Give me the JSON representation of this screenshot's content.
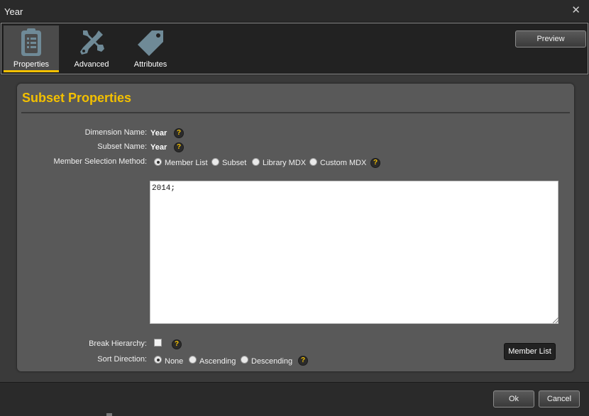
{
  "window": {
    "title": "Year",
    "close_glyph": "✕"
  },
  "toolbar": {
    "tabs": [
      {
        "label": "Properties",
        "icon": "clipboard-icon",
        "active": true
      },
      {
        "label": "Advanced",
        "icon": "tools-icon",
        "active": false
      },
      {
        "label": "Attributes",
        "icon": "tag-icon",
        "active": false
      }
    ],
    "preview_label": "Preview"
  },
  "panel": {
    "heading": "Subset Properties",
    "dimension_label": "Dimension Name:",
    "dimension_value": "Year",
    "subset_label": "Subset Name:",
    "subset_value": "Year",
    "method_label": "Member Selection Method:",
    "method_options": [
      "Member List",
      "Subset",
      "Library MDX",
      "Custom MDX"
    ],
    "method_selected": "Member List",
    "editor_text": "2014;",
    "break_label": "Break Hierarchy:",
    "break_checked": false,
    "sort_label": "Sort Direction:",
    "sort_options": [
      "None",
      "Ascending",
      "Descending"
    ],
    "sort_selected": "None",
    "member_list_button": "Member List",
    "help_glyph": "?"
  },
  "footer": {
    "ok_label": "Ok",
    "cancel_label": "Cancel"
  },
  "colors": {
    "accent": "#f3c000",
    "panel": "#595959",
    "chrome": "#2a2a2a"
  }
}
